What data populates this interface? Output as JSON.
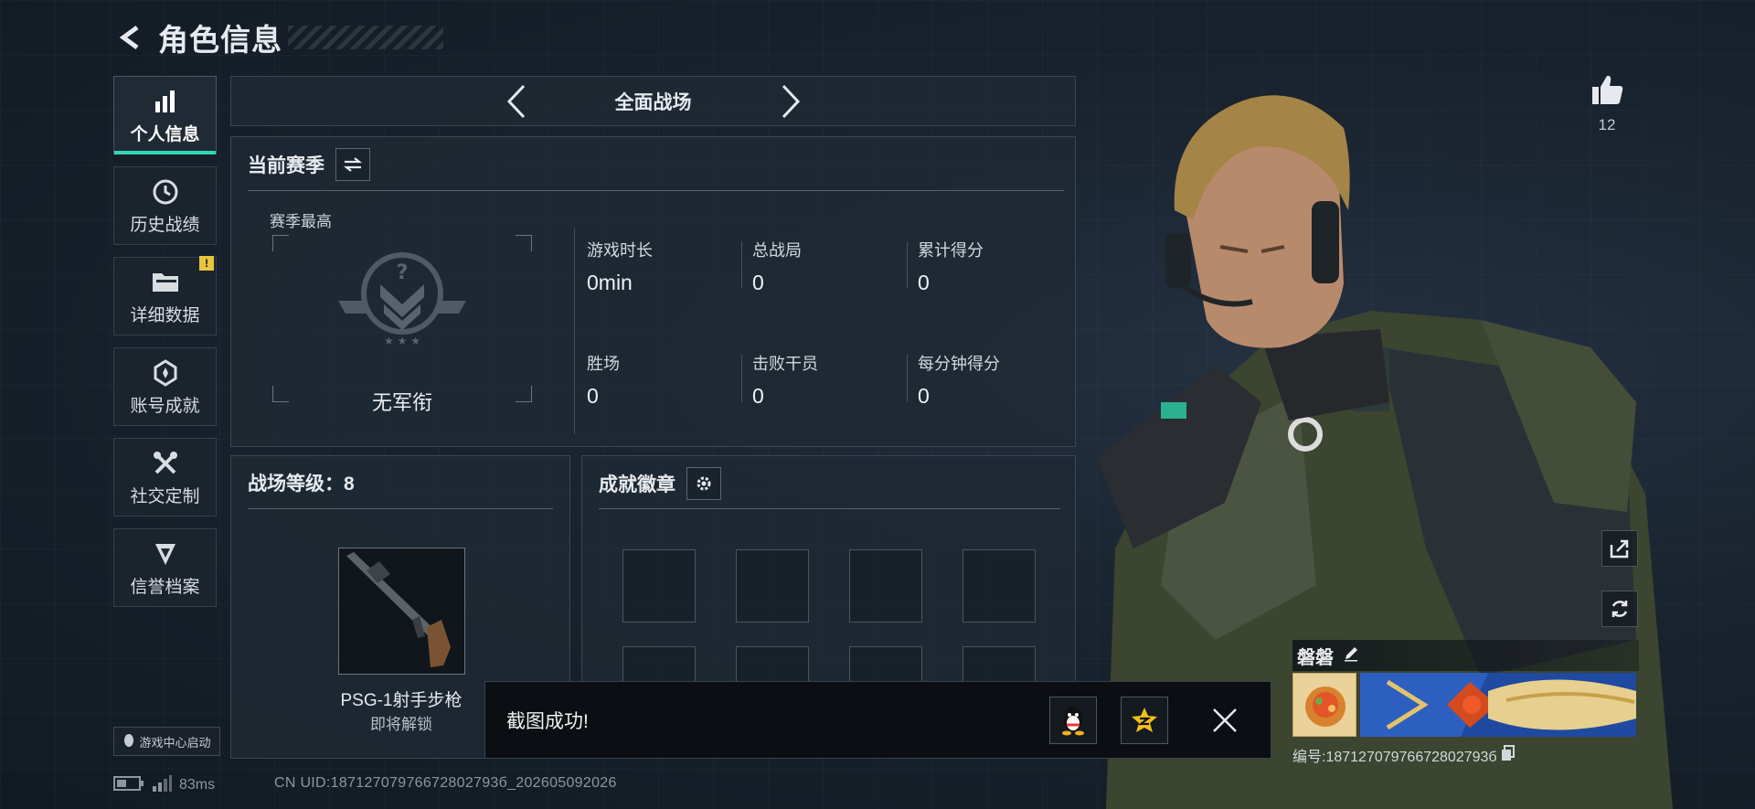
{
  "header": {
    "title": "角色信息"
  },
  "nav": {
    "items": [
      {
        "label": "个人信息",
        "icon": "bar-chart-icon",
        "active": true
      },
      {
        "label": "历史战绩",
        "icon": "history-icon"
      },
      {
        "label": "详细数据",
        "icon": "folder-icon",
        "alert": "!"
      },
      {
        "label": "账号成就",
        "icon": "achievement-icon"
      },
      {
        "label": "社交定制",
        "icon": "tools-icon"
      },
      {
        "label": "信誉档案",
        "icon": "credit-icon"
      }
    ],
    "game_center_label": "游戏中心启动"
  },
  "mode_bar": {
    "title": "全面战场"
  },
  "season": {
    "title": "当前赛季",
    "best_label": "赛季最高",
    "rank_name": "无军衔",
    "stats": [
      {
        "label": "游戏时长",
        "value": "0min"
      },
      {
        "label": "总战局",
        "value": "0"
      },
      {
        "label": "累计得分",
        "value": "0"
      },
      {
        "label": "胜场",
        "value": "0"
      },
      {
        "label": "击败干员",
        "value": "0"
      },
      {
        "label": "每分钟得分",
        "value": "0"
      }
    ]
  },
  "level_panel": {
    "title": "战场等级：8",
    "weapon_name": "PSG-1射手步枪",
    "weapon_status": "即将解锁"
  },
  "badge_panel": {
    "title": "成就徽章"
  },
  "status_bar": {
    "ping": "83ms",
    "uid": "CN UID:18712707976672802793б_202605092026"
  },
  "toast": {
    "message": "截图成功!"
  },
  "profile": {
    "like_count": "12",
    "name": "磐磐",
    "id_text": "编号:18712707976672802793б"
  },
  "colors": {
    "accent": "#31d6b5",
    "alert": "#e8c540",
    "panel": "#202933"
  }
}
